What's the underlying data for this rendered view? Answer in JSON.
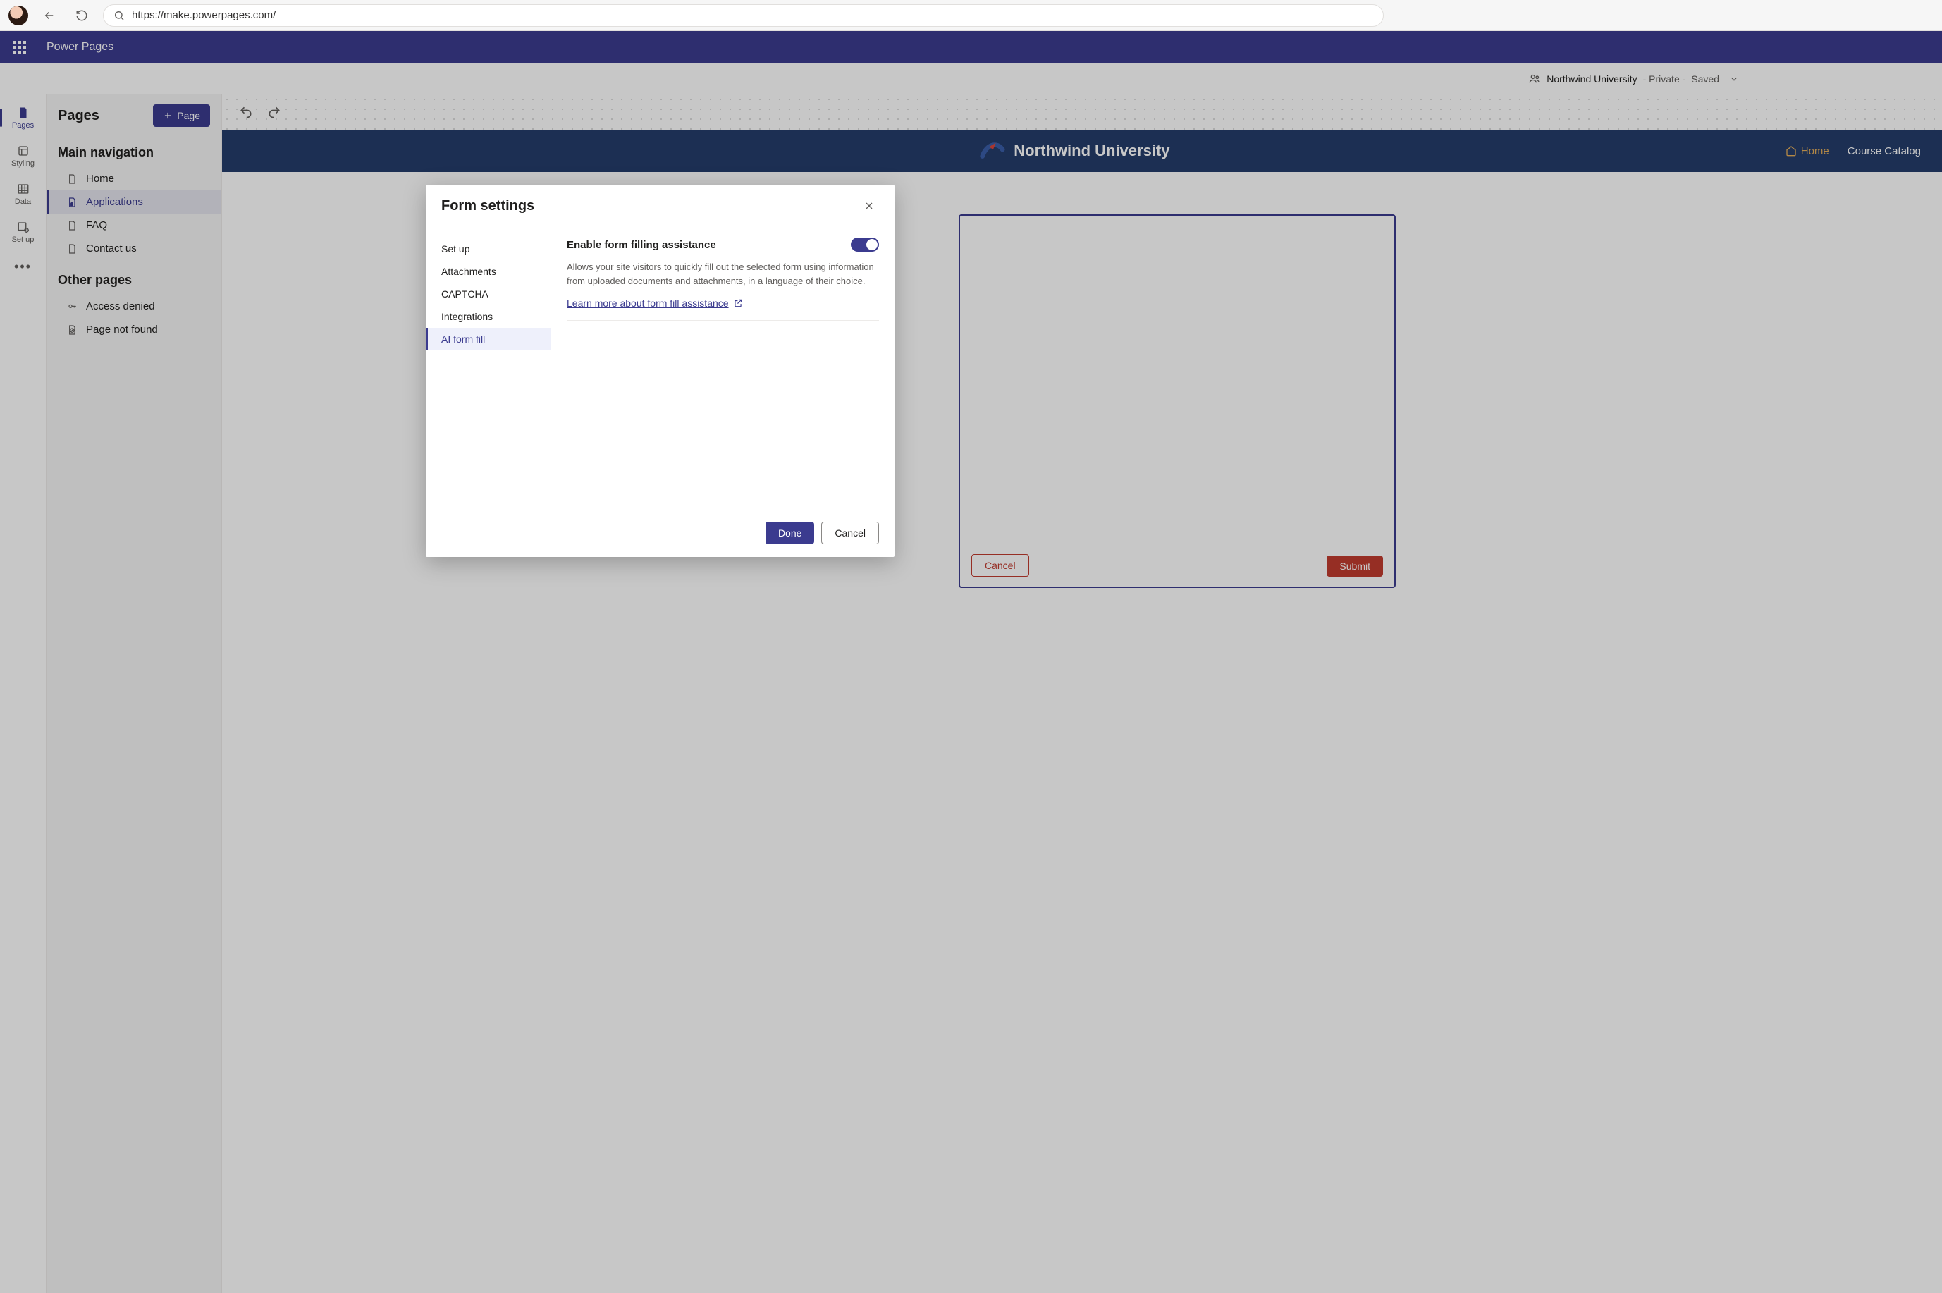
{
  "browser": {
    "url": "https://make.powerpages.com/"
  },
  "suite": {
    "product_name": "Power Pages"
  },
  "site_header": {
    "site_name": "Northwind University",
    "visibility": "Private",
    "save_state": "Saved"
  },
  "left_rail": {
    "items": [
      {
        "label": "Pages"
      },
      {
        "label": "Styling"
      },
      {
        "label": "Data"
      },
      {
        "label": "Set up"
      }
    ]
  },
  "pages_panel": {
    "title": "Pages",
    "add_button": "Page",
    "sections": {
      "main_nav_title": "Main navigation",
      "main_nav_items": [
        {
          "label": "Home"
        },
        {
          "label": "Applications"
        },
        {
          "label": "FAQ"
        },
        {
          "label": "Contact us"
        }
      ],
      "other_title": "Other pages",
      "other_items": [
        {
          "label": "Access denied"
        },
        {
          "label": "Page not found"
        }
      ]
    }
  },
  "site_preview": {
    "title": "Northwind University",
    "nav_home": "Home",
    "nav_catalog": "Course Catalog",
    "form": {
      "cancel": "Cancel",
      "submit": "Submit"
    }
  },
  "dialog": {
    "title": "Form settings",
    "tabs": [
      {
        "label": "Set up"
      },
      {
        "label": "Attachments"
      },
      {
        "label": "CAPTCHA"
      },
      {
        "label": "Integrations"
      },
      {
        "label": "AI form fill"
      }
    ],
    "content": {
      "toggle_label": "Enable form filling assistance",
      "toggle_on": true,
      "description": "Allows your site visitors to quickly fill out the selected form using information from uploaded documents and attachments, in a language of their choice.",
      "link_text": "Learn more about form fill assistance"
    },
    "footer": {
      "primary": "Done",
      "secondary": "Cancel"
    }
  }
}
